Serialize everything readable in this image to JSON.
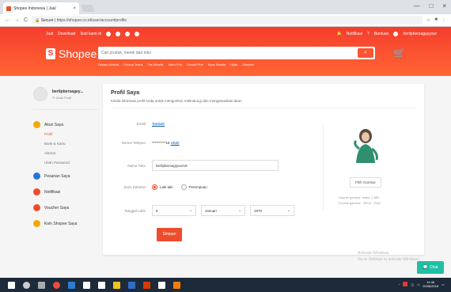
{
  "browser": {
    "tab_title": "Shopee Indonesia | Jual",
    "tab_close": "×",
    "url_secure": "Secure",
    "url": "https://shopee.co.id/user/account/profile",
    "nav_back": "←",
    "nav_forward": "→",
    "nav_reload": "C",
    "win_min": "—",
    "win_max": "□",
    "win_close": "×"
  },
  "header": {
    "top_left": [
      "Jual",
      "Download",
      "Ikuti kami di"
    ],
    "top_right": [
      "Notifikasi",
      "Bantuan",
      "berlipbersaguyyour"
    ],
    "logo_glyph": "S",
    "logo": "Shopee",
    "search_placeholder": "Cari produk, merek dan toko",
    "search_icon": "⌕",
    "cart_icon": "🛒",
    "hints": [
      "Sepatu Wanita",
      "Celana Jeans",
      "Tas Wanita",
      "Jaket Pria",
      "Sandal Pria",
      "Kaos Wanita",
      "Hijab",
      "Sweater"
    ]
  },
  "sidebar": {
    "username": "berlipbersagey...",
    "edit": "✎ Ubah Profil",
    "menu": [
      {
        "label": "Akun Saya",
        "color": "#f6a700"
      },
      {
        "label": "Pesanan Saya",
        "color": "#2673dd"
      },
      {
        "label": "Notifikasi",
        "color": "#ee4d2d"
      },
      {
        "label": "Voucher Saya",
        "color": "#ee4d2d"
      },
      {
        "label": "Koin Shopee Saya",
        "color": "#f6a700"
      }
    ],
    "submenu": [
      "Profil",
      "Bank & Kartu",
      "Alamat",
      "Ubah Password"
    ]
  },
  "profile": {
    "title": "Profil Saya",
    "subtitle": "Kelola informasi profil Anda untuk mengontrol, melindungi dan mengamankan akun",
    "email_label": "Email",
    "email_value": "Tambah",
    "phone_label": "Nomor Telepon",
    "phone_value": "**********18",
    "phone_link": "Ubah",
    "shop_label": "Nama Toko",
    "shop_value": "berlipbersagiyour19",
    "gender_label": "Jenis Kelamin",
    "gender_male": "Laki-laki",
    "gender_female": "Perempuan",
    "dob_label": "Tanggal Lahir",
    "dob_day": "6",
    "dob_month": "Januari",
    "dob_year": "1970",
    "save": "Simpan",
    "pick_image": "Pilih Gambar",
    "image_note_1": "Ukuran gambar: maks. 1 MB",
    "image_note_2": "Format gambar: .JPEG, .PNG"
  },
  "overlay": {
    "activate_1": "Activate Windows",
    "activate_2": "Go to Settings to activate Windows.",
    "chat": "Chat"
  },
  "taskbar": {
    "time": "14:46",
    "date": "20/06/2018"
  }
}
